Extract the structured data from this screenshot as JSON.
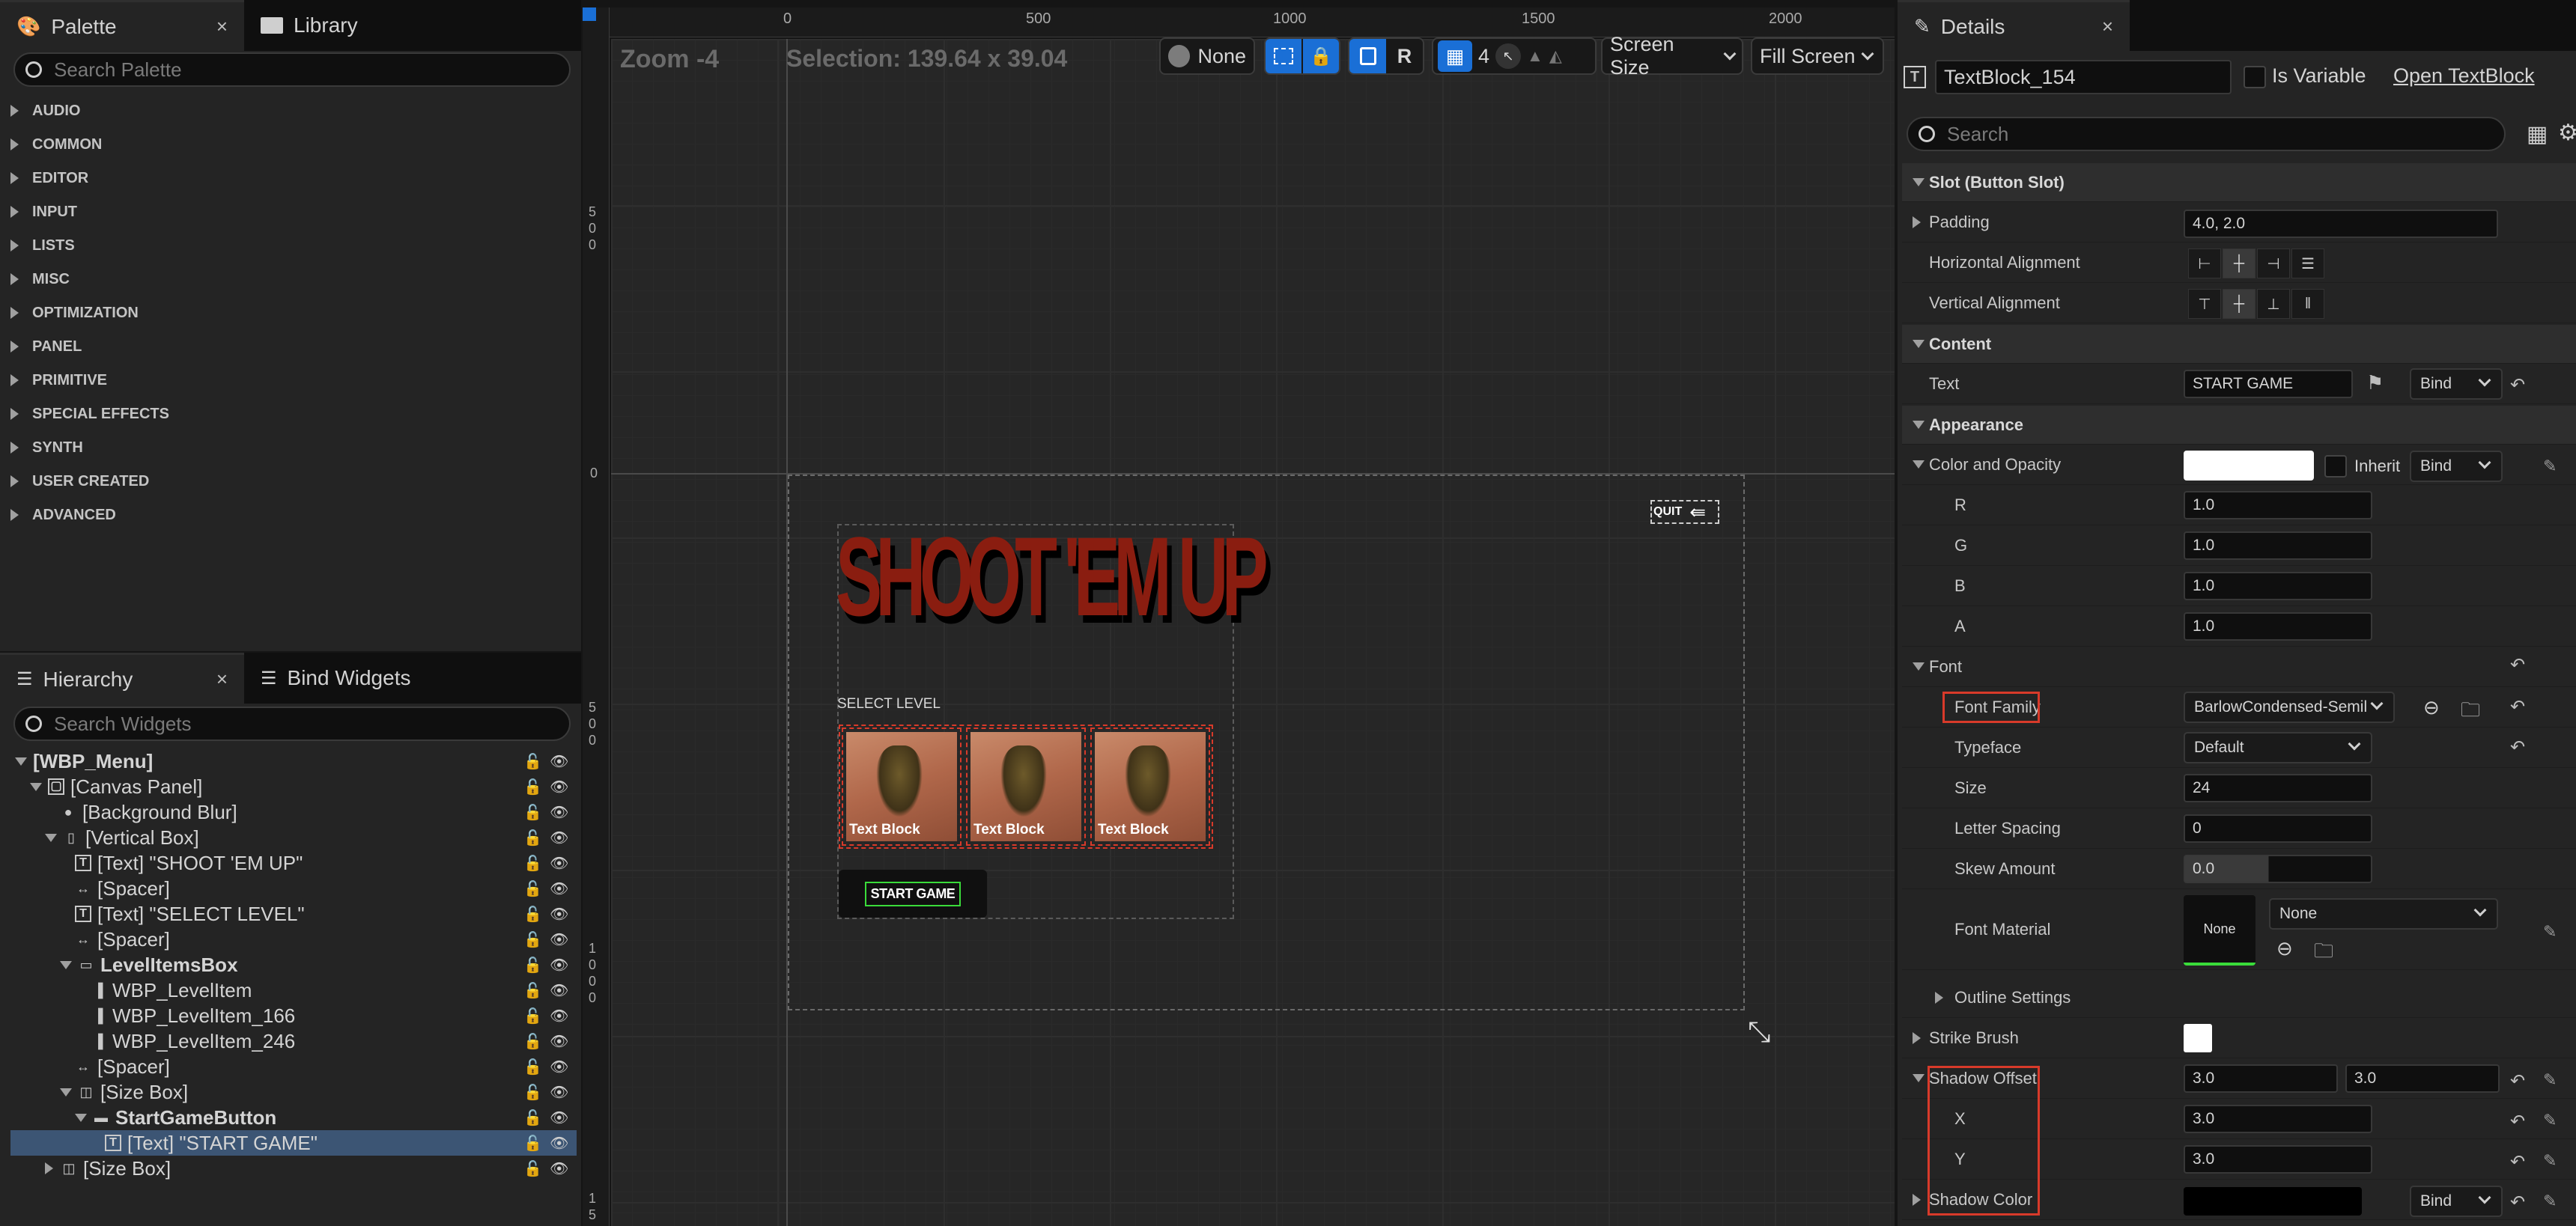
{
  "palette": {
    "tab_label": "Palette",
    "close_glyph": "×",
    "library_tab_label": "Library",
    "search_placeholder": "Search Palette",
    "categories": [
      "AUDIO",
      "COMMON",
      "EDITOR",
      "INPUT",
      "LISTS",
      "MISC",
      "OPTIMIZATION",
      "PANEL",
      "PRIMITIVE",
      "SPECIAL EFFECTS",
      "SYNTH",
      "USER CREATED",
      "ADVANCED"
    ]
  },
  "hierarchy": {
    "tab_label": "Hierarchy",
    "close_glyph": "×",
    "bind_tab_label": "Bind Widgets",
    "search_placeholder": "Search Widgets",
    "items": [
      {
        "label": "[WBP_Menu]",
        "depth": 0,
        "expander": "down",
        "icon": "",
        "bold": true
      },
      {
        "label": "[Canvas Panel]",
        "depth": 1,
        "expander": "down",
        "icon": "canvas-icon",
        "bold": false
      },
      {
        "label": "[Background Blur]",
        "depth": 2,
        "expander": "",
        "icon": "blur-icon",
        "bold": false
      },
      {
        "label": "[Vertical Box]",
        "depth": 2,
        "expander": "down",
        "icon": "vbox-icon",
        "bold": false
      },
      {
        "label": "[Text] \"SHOOT 'EM UP\"",
        "depth": 3,
        "expander": "",
        "icon": "text-icon",
        "bold": false
      },
      {
        "label": "[Spacer]",
        "depth": 3,
        "expander": "",
        "icon": "spacer-icon",
        "bold": false
      },
      {
        "label": "[Text] \"SELECT LEVEL\"",
        "depth": 3,
        "expander": "",
        "icon": "text-icon",
        "bold": false
      },
      {
        "label": "[Spacer]",
        "depth": 3,
        "expander": "",
        "icon": "spacer-icon",
        "bold": false
      },
      {
        "label": "LevelItemsBox",
        "depth": 3,
        "expander": "down",
        "icon": "hbox-icon",
        "bold": true
      },
      {
        "label": "WBP_LevelItem",
        "depth": 4,
        "expander": "",
        "icon": "widget-icon",
        "bold": false
      },
      {
        "label": "WBP_LevelItem_166",
        "depth": 4,
        "expander": "",
        "icon": "widget-icon",
        "bold": false
      },
      {
        "label": "WBP_LevelItem_246",
        "depth": 4,
        "expander": "",
        "icon": "widget-icon",
        "bold": false
      },
      {
        "label": "[Spacer]",
        "depth": 3,
        "expander": "",
        "icon": "spacer-icon",
        "bold": false
      },
      {
        "label": "[Size Box]",
        "depth": 3,
        "expander": "down",
        "icon": "sizebox-icon",
        "bold": false
      },
      {
        "label": "StartGameButton",
        "depth": 4,
        "expander": "down",
        "icon": "button-icon",
        "bold": true
      },
      {
        "label": "[Text] \"START GAME\"",
        "depth": 5,
        "expander": "",
        "icon": "text-icon",
        "bold": false,
        "selected": true
      },
      {
        "label": "[Size Box]",
        "depth": 2,
        "expander": "right",
        "icon": "sizebox-icon",
        "bold": false
      }
    ]
  },
  "canvas": {
    "zoom_label": "Zoom -4",
    "selection_label": "Selection: 139.64 x 39.04",
    "ruler_top_ticks": [
      "0",
      "500",
      "1000",
      "1500",
      "2000"
    ],
    "ruler_left_ticks": [
      "500",
      "0",
      "500",
      "1000",
      "15"
    ],
    "toolbar": {
      "none_label": "None",
      "r_label": "R",
      "grid_value": "4",
      "screen_size_label": "Screen Size",
      "fill_screen_label": "Fill Screen"
    },
    "preview": {
      "title": "SHOOT 'EM UP",
      "select_level": "SELECT LEVEL",
      "level_label": "Text Block",
      "start_game": "START GAME",
      "quit": "QUIT"
    }
  },
  "details": {
    "tab_label": "Details",
    "close_glyph": "×",
    "widget_name": "TextBlock_154",
    "is_variable_label": "Is Variable",
    "open_link": "Open TextBlock",
    "search_placeholder": "Search",
    "sections": {
      "slot": "Slot (Button Slot)",
      "content": "Content",
      "appearance": "Appearance"
    },
    "padding_label": "Padding",
    "padding_value": "4.0, 2.0",
    "h_align_label": "Horizontal Alignment",
    "v_align_label": "Vertical Alignment",
    "text_label": "Text",
    "text_value": "START GAME",
    "bind_label": "Bind",
    "color_label": "Color and Opacity",
    "inherit_label": "Inherit",
    "r_label": "R",
    "r_value": "1.0",
    "g_label": "G",
    "g_value": "1.0",
    "b_label": "B",
    "b_value": "1.0",
    "a_label": "A",
    "a_value": "1.0",
    "font_label": "Font",
    "font_family_label": "Font Family",
    "font_family_value": "BarlowCondensed-Semil",
    "typeface_label": "Typeface",
    "typeface_value": "Default",
    "size_label": "Size",
    "size_value": "24",
    "letter_spacing_label": "Letter Spacing",
    "letter_spacing_value": "0",
    "skew_label": "Skew Amount",
    "skew_value": "0.0",
    "font_material_label": "Font Material",
    "font_material_thumb": "None",
    "font_material_value": "None",
    "outline_label": "Outline Settings",
    "strike_label": "Strike Brush",
    "shadow_offset_label": "Shadow Offset",
    "shadow_offset_x": "3.0",
    "shadow_offset_y": "3.0",
    "x_label": "X",
    "x_value": "3.0",
    "y_label": "Y",
    "y_value": "3.0",
    "shadow_color_label": "Shadow Color"
  },
  "colors": {
    "accent_blue": "#1a6fd6",
    "selection_row": "#3c5574",
    "highlight_red": "#d83a2a",
    "title_red": "#8a1d10"
  }
}
